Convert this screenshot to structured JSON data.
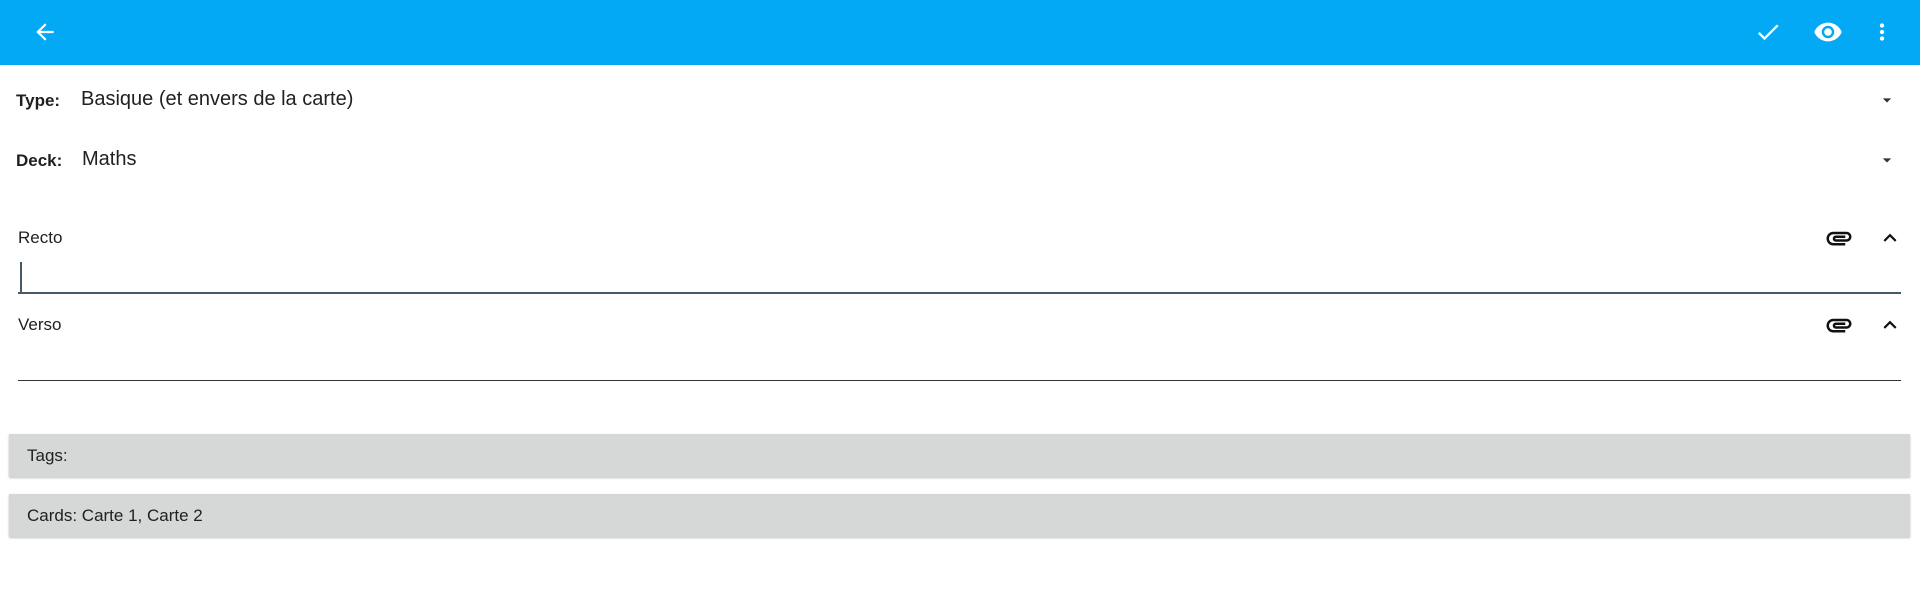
{
  "toolbar": {
    "back_icon": "arrow-back-icon",
    "save_icon": "check-icon",
    "preview_icon": "eye-icon",
    "more_icon": "more-vert-icon",
    "background_color": "#03a9f4"
  },
  "note_type": {
    "label": "Type:",
    "value": "Basique (et envers de la carte)"
  },
  "deck": {
    "label": "Deck:",
    "value": "Maths"
  },
  "fields": [
    {
      "name": "Recto",
      "value": ""
    },
    {
      "name": "Verso",
      "value": ""
    }
  ],
  "tags_button": {
    "label": "Tags:"
  },
  "cards_button": {
    "label": "Cards: Carte 1, Carte 2"
  }
}
